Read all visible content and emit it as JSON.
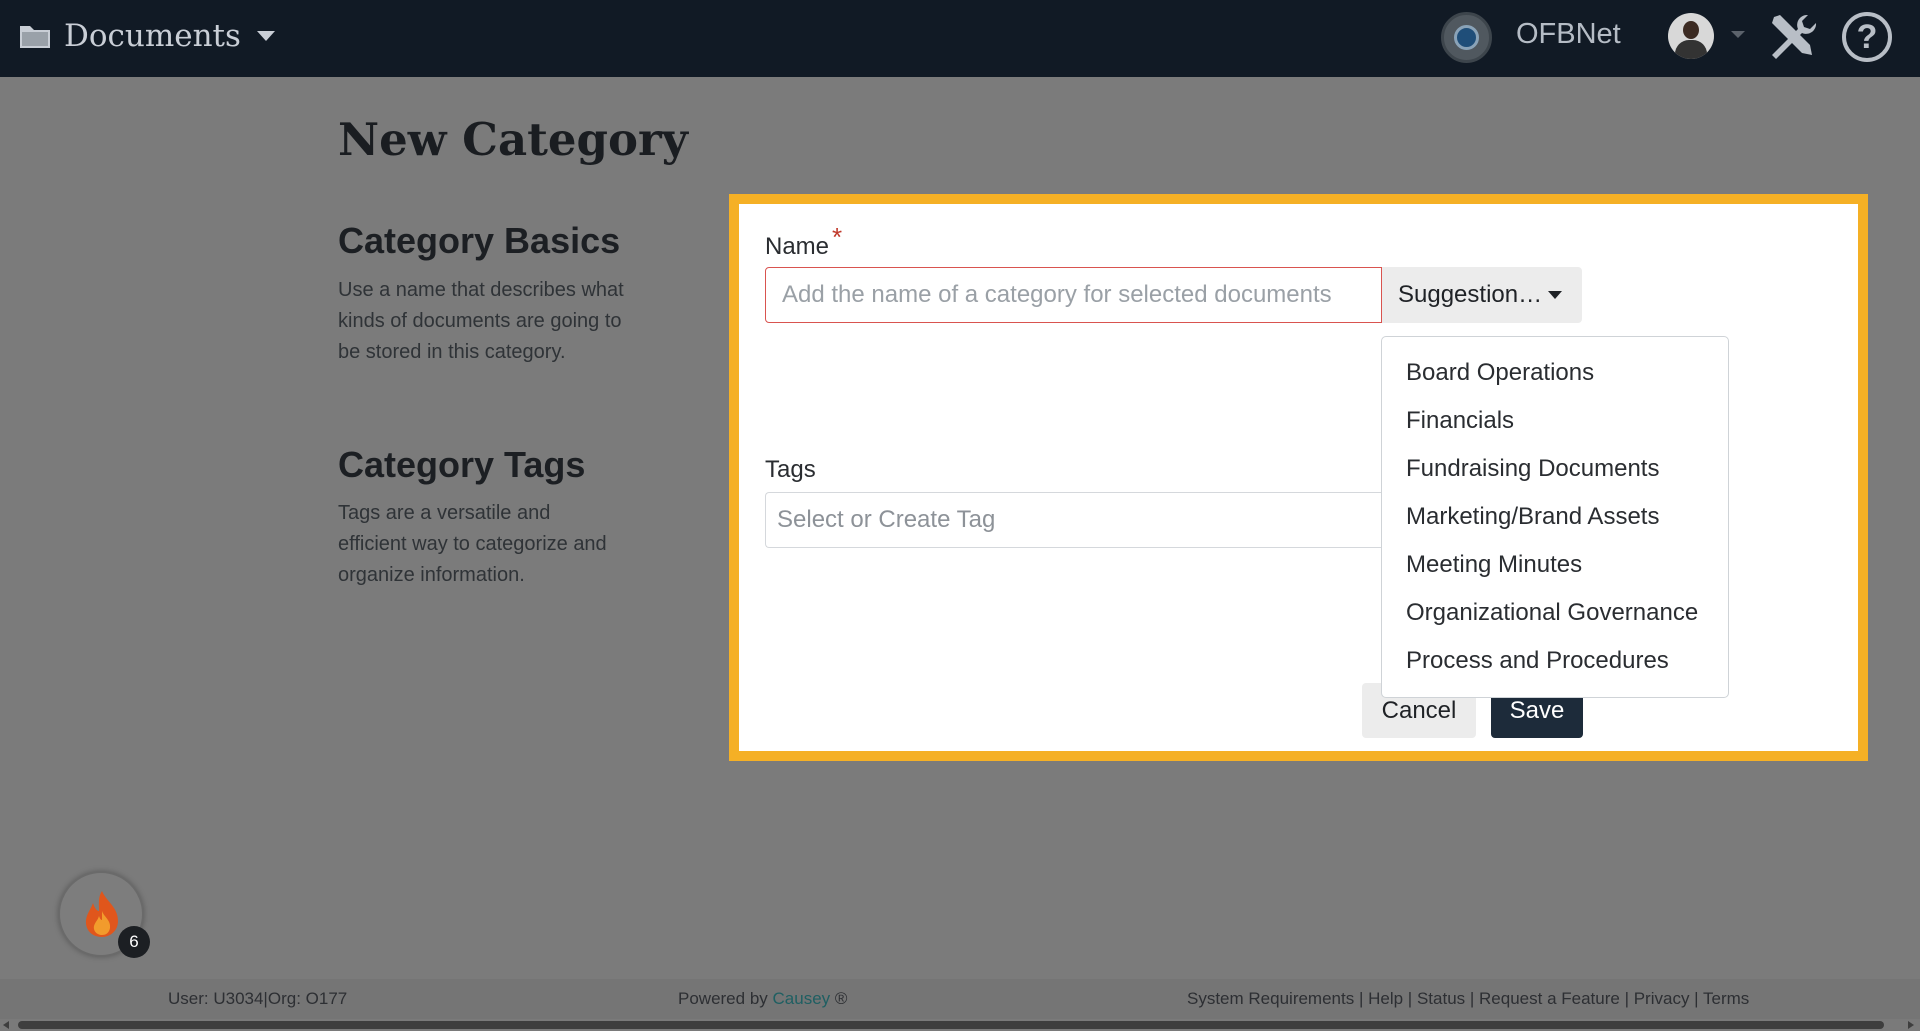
{
  "topbar": {
    "app_title": "Documents",
    "org_name": "OFBNet",
    "icons": {
      "app": "folder-icon",
      "app_menu": "caret-down-icon",
      "org": "org-logo",
      "user": "avatar",
      "user_menu": "caret-down-icon",
      "tools": "tools-icon",
      "help": "help-icon"
    }
  },
  "page": {
    "title": "New Category",
    "basics_heading": "Category Basics",
    "basics_text": "Use a name that describes what kinds of documents are going to be stored in this category.",
    "tags_heading": "Category Tags",
    "tags_text": "Tags are a versatile and efficient way to categorize and organize information."
  },
  "form": {
    "name_label": "Name",
    "required_mark": "*",
    "name_value": "",
    "name_placeholder": "Add the name of a category for selected documents",
    "suggestion_label": "Suggestion…",
    "suggestions": [
      "Board Operations",
      "Financials",
      "Fundraising Documents",
      "Marketing/Brand Assets",
      "Meeting Minutes",
      "Organizational Governance",
      "Process and Procedures"
    ],
    "tags_label": "Tags",
    "tags_placeholder": "Select or Create Tag",
    "cancel_label": "Cancel",
    "save_label": "Save"
  },
  "widget": {
    "icon": "fire-icon",
    "badge_count": "6"
  },
  "footer": {
    "user_info": "User: U3034|Org: O177",
    "powered_prefix": "Powered by",
    "powered_brand": "Causey",
    "powered_suffix": "®",
    "links": [
      "System Requirements",
      "Help",
      "Status",
      "Request a Feature",
      "Privacy",
      "Terms"
    ],
    "separator": " | "
  },
  "colors": {
    "topbar": "#111a25",
    "highlight_border": "#f5b025",
    "save_button": "#1d2b3a",
    "required": "#c0392b",
    "brand_link": "#1f5f62"
  }
}
